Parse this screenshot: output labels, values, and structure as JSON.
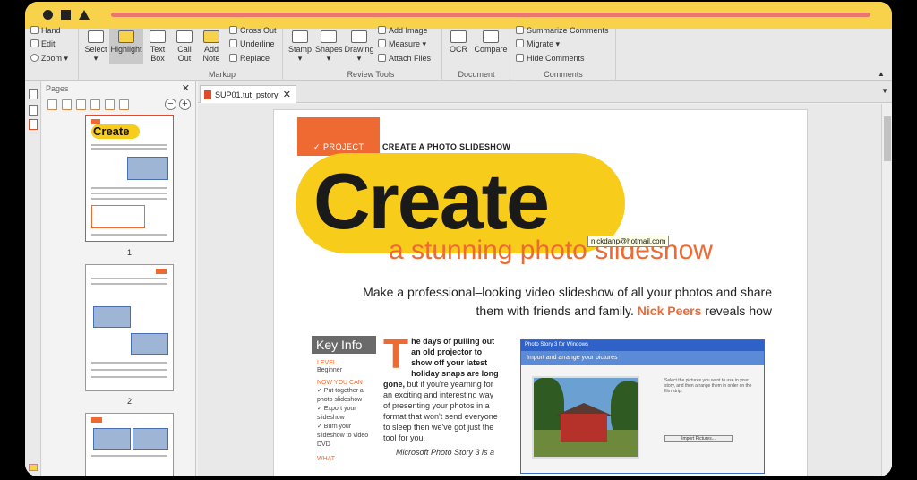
{
  "ribbon": {
    "hand": "Hand",
    "edit": "Edit",
    "zoom": "Zoom",
    "select": "Select",
    "highlight": "Highlight",
    "text_box": [
      "Text",
      "Box"
    ],
    "call_out": [
      "Call",
      "Out"
    ],
    "add_note": [
      "Add",
      "Note"
    ],
    "cross_out": "Cross Out",
    "underline": "Underline",
    "replace": "Replace",
    "markup_label": "Markup",
    "stamp": "Stamp",
    "shapes": "Shapes",
    "drawing": "Drawing",
    "add_image": "Add Image",
    "measure": "Measure",
    "attach_files": "Attach Files",
    "review_tools_label": "Review Tools",
    "ocr": "OCR",
    "compare": "Compare",
    "document_label": "Document",
    "summarize_comments": "Summarize Comments",
    "migrate": "Migrate",
    "hide_comments": "Hide Comments",
    "comments_label": "Comments"
  },
  "pages_panel": {
    "title": "Pages",
    "page_numbers": [
      "1",
      "2"
    ]
  },
  "document": {
    "tab_name": "SUP01.tut_pstory",
    "project_tag": "✓ PROJECT",
    "project_title": "CREATE A PHOTO SLIDESHOW",
    "headline": "Create",
    "subtitle": "a stunning photo slideshow",
    "intro": "Make a professional–looking video slideshow of all your photos and share them with friends and family.",
    "author": "Nick Peers",
    "author_suffix": "reveals how",
    "tooltip": "nickdanp@hotmail.com",
    "key_info": {
      "title": "Key Info",
      "level_label": "LEVEL",
      "level_value": "Beginner",
      "now_label": "NOW YOU CAN",
      "items": [
        "✓ Put together a photo slideshow",
        "✓ Export your slideshow",
        "✓ Burn your slideshow to video DVD"
      ],
      "what_label": "WHAT"
    },
    "body_drop": "T",
    "body_lead": "he days of pulling out an old projector to show off your latest holiday snaps are long gone,",
    "body_text": "but if you're yearning for an exciting and interesting way of presenting your photos in a format that won't send everyone to sleep then we've got just the tool for you.",
    "body_more": "Microsoft Photo Story 3 is a",
    "screenshot": {
      "window_title": "Photo Story 3 for Windows",
      "header": "Import and arrange your pictures",
      "instructions": "Select the pictures you want to use in your story, and then arrange them in order on the film strip.",
      "import_button": "Import Pictures..."
    }
  }
}
